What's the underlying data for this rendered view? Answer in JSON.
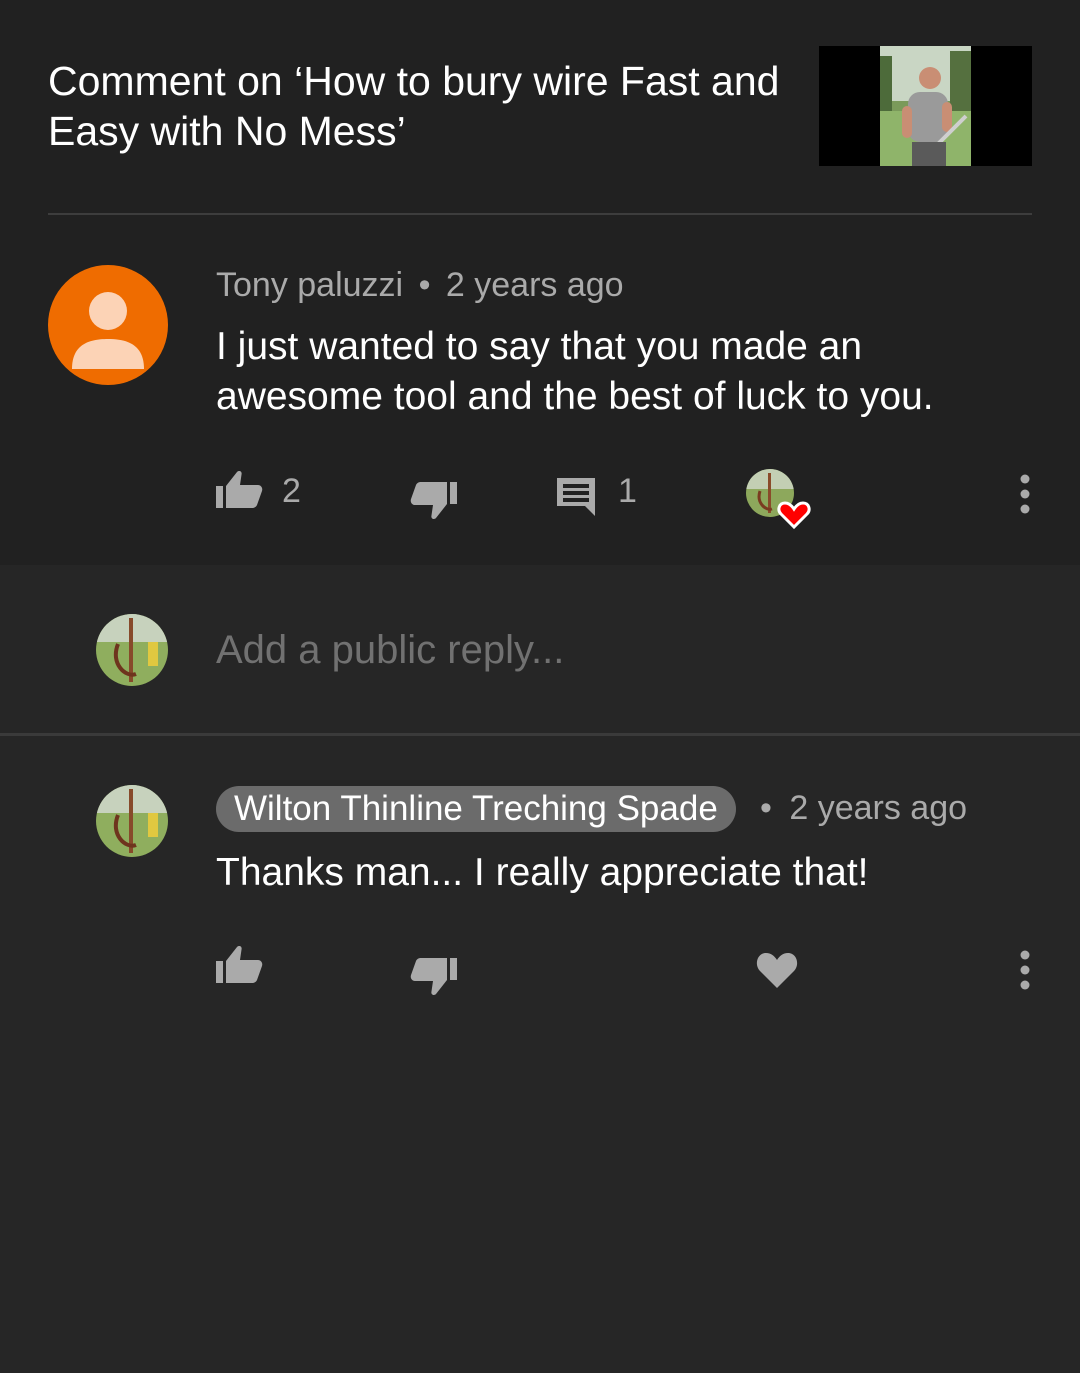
{
  "header": {
    "title": "Comment on ‘How to bury wire Fast and Easy with No Mess’",
    "thumbnail_icon": "video-thumbnail"
  },
  "comment": {
    "author": "Tony paluzzi",
    "separator": "•",
    "time": "2 years ago",
    "text": "I just wanted to say that you made an awesome tool and the best of luck to you.",
    "likes": "2",
    "replies": "1",
    "heart_icon": "creator-heart-icon",
    "avatar_color": "#ef6c00"
  },
  "reply_input": {
    "placeholder": "Add a public reply..."
  },
  "reply": {
    "author": "Wilton Thinline Treching Spade",
    "separator": "•",
    "time": "2 years ago",
    "text": "Thanks man... I really appreciate that!"
  },
  "colors": {
    "background": "#262626",
    "top_background": "#212121",
    "secondary_text": "#aaaaaa",
    "heart_red": "#ff0000",
    "chip": "#6b6b6b"
  }
}
